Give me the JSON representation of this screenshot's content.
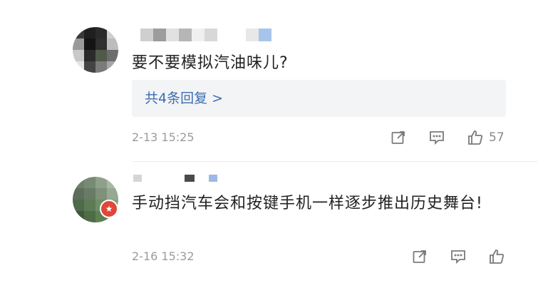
{
  "comments": [
    {
      "text": "要不要模拟汽油味儿?",
      "replies_label": "共4条回复 >",
      "time": "2-13 15:25",
      "likes": "57",
      "icons": [
        "share-icon",
        "reply-icon",
        "like-icon"
      ]
    },
    {
      "text": "手动挡汽车会和按键手机一样逐步推出历史舞台!",
      "time": "2-16 15:32",
      "badge_icon": "verified-badge-icon",
      "icons": [
        "share-icon",
        "reply-icon",
        "like-icon"
      ]
    }
  ],
  "colors": {
    "reply_link": "#3b6db3",
    "badge": "#e0473a",
    "text": "#222222",
    "muted": "#9b9b9b"
  }
}
